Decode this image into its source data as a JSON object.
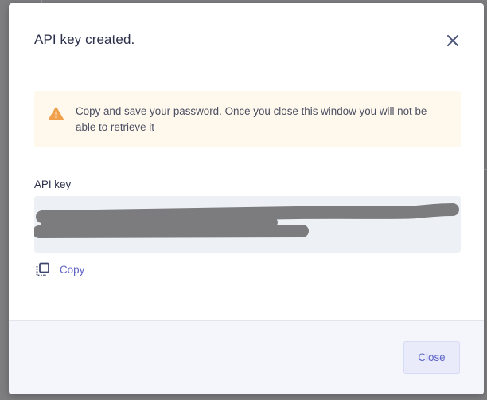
{
  "modal": {
    "title": "API key created.",
    "close_icon": "close-icon"
  },
  "warning": {
    "icon": "warning-triangle-icon",
    "text": "Copy and save your password. Once you close this window you will not be able to retrieve it"
  },
  "api_key": {
    "label": "API key",
    "value_redacted": true
  },
  "copy": {
    "icon": "copy-icon",
    "label": "Copy"
  },
  "footer": {
    "close_label": "Close"
  },
  "colors": {
    "accent": "#5d64c6",
    "warning_bg": "#fff8ec",
    "warning_icon": "#f0a04b",
    "key_box_bg": "#edf1f5",
    "redaction": "#7c7c7e",
    "backdrop": "#7e7e80"
  }
}
